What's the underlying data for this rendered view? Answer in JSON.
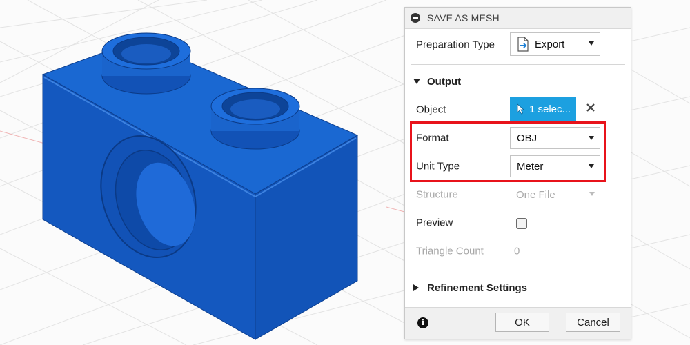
{
  "dialog": {
    "title": "SAVE AS MESH",
    "preparation_type": {
      "label": "Preparation Type",
      "value": "Export",
      "icon": "export-icon"
    },
    "output_section": {
      "label": "Output",
      "expanded": true
    },
    "object": {
      "label": "Object",
      "selection": "1 selec...",
      "icon": "cursor-icon",
      "clear_icon": "close-icon"
    },
    "format": {
      "label": "Format",
      "value": "OBJ"
    },
    "unit_type": {
      "label": "Unit Type",
      "value": "Meter"
    },
    "structure": {
      "label": "Structure",
      "value": "One File",
      "disabled": true
    },
    "preview": {
      "label": "Preview",
      "checked": false
    },
    "triangle_count": {
      "label": "Triangle Count",
      "value": "0",
      "disabled": true
    },
    "refinement_section": {
      "label": "Refinement Settings",
      "expanded": false
    },
    "ok_label": "OK",
    "cancel_label": "Cancel",
    "info_icon": "info-icon"
  },
  "colors": {
    "model_blue": "#1660c8",
    "selection_blue": "#1ca0e0",
    "highlight_red": "#e8131b"
  }
}
